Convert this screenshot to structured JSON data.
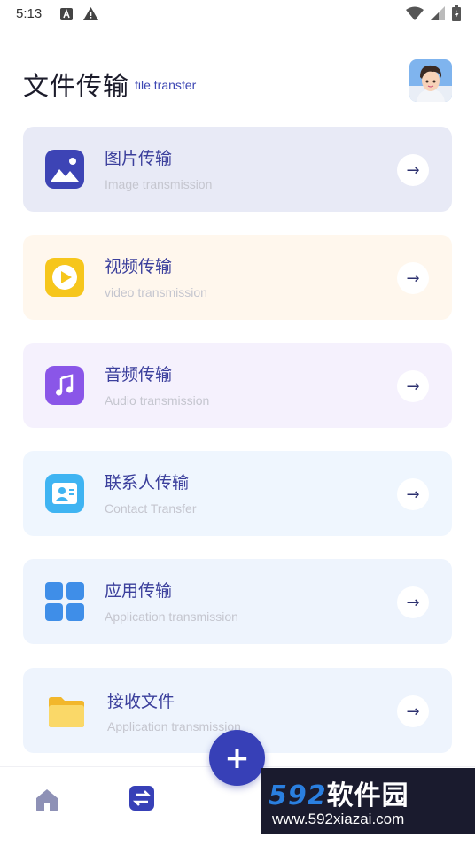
{
  "status_bar": {
    "time": "5:13"
  },
  "header": {
    "title": "文件传输",
    "subtitle": "file transfer"
  },
  "cards": [
    {
      "title": "图片传输",
      "subtitle": "Image transmission",
      "icon": "image-icon",
      "bg": "#e8eaf6",
      "accent": "#3d44b5"
    },
    {
      "title": "视频传输",
      "subtitle": "video transmission",
      "icon": "play-icon",
      "bg": "#fff7ed",
      "accent": "#f6c61c"
    },
    {
      "title": "音频传输",
      "subtitle": "Audio transmission",
      "icon": "music-icon",
      "bg": "#f5f1fd",
      "accent": "#8a56e8"
    },
    {
      "title": "联系人传输",
      "subtitle": "Contact Transfer",
      "icon": "contact-icon",
      "bg": "#eff6fe",
      "accent": "#3fb4f2"
    },
    {
      "title": "应用传输",
      "subtitle": "Application transmission",
      "icon": "apps-icon",
      "bg": "#eef4fd",
      "accent": "#3f8ee8"
    },
    {
      "title": "接收文件",
      "subtitle": "Application transmission",
      "icon": "folder-icon",
      "bg": "#eef4fd",
      "accent": "#f6c83c"
    }
  ],
  "arrow_symbol": "→",
  "fab": {
    "symbol": "+"
  },
  "watermark": {
    "brand": "592",
    "brand_cn": "软件园",
    "url": "www.592xiazai.com"
  }
}
